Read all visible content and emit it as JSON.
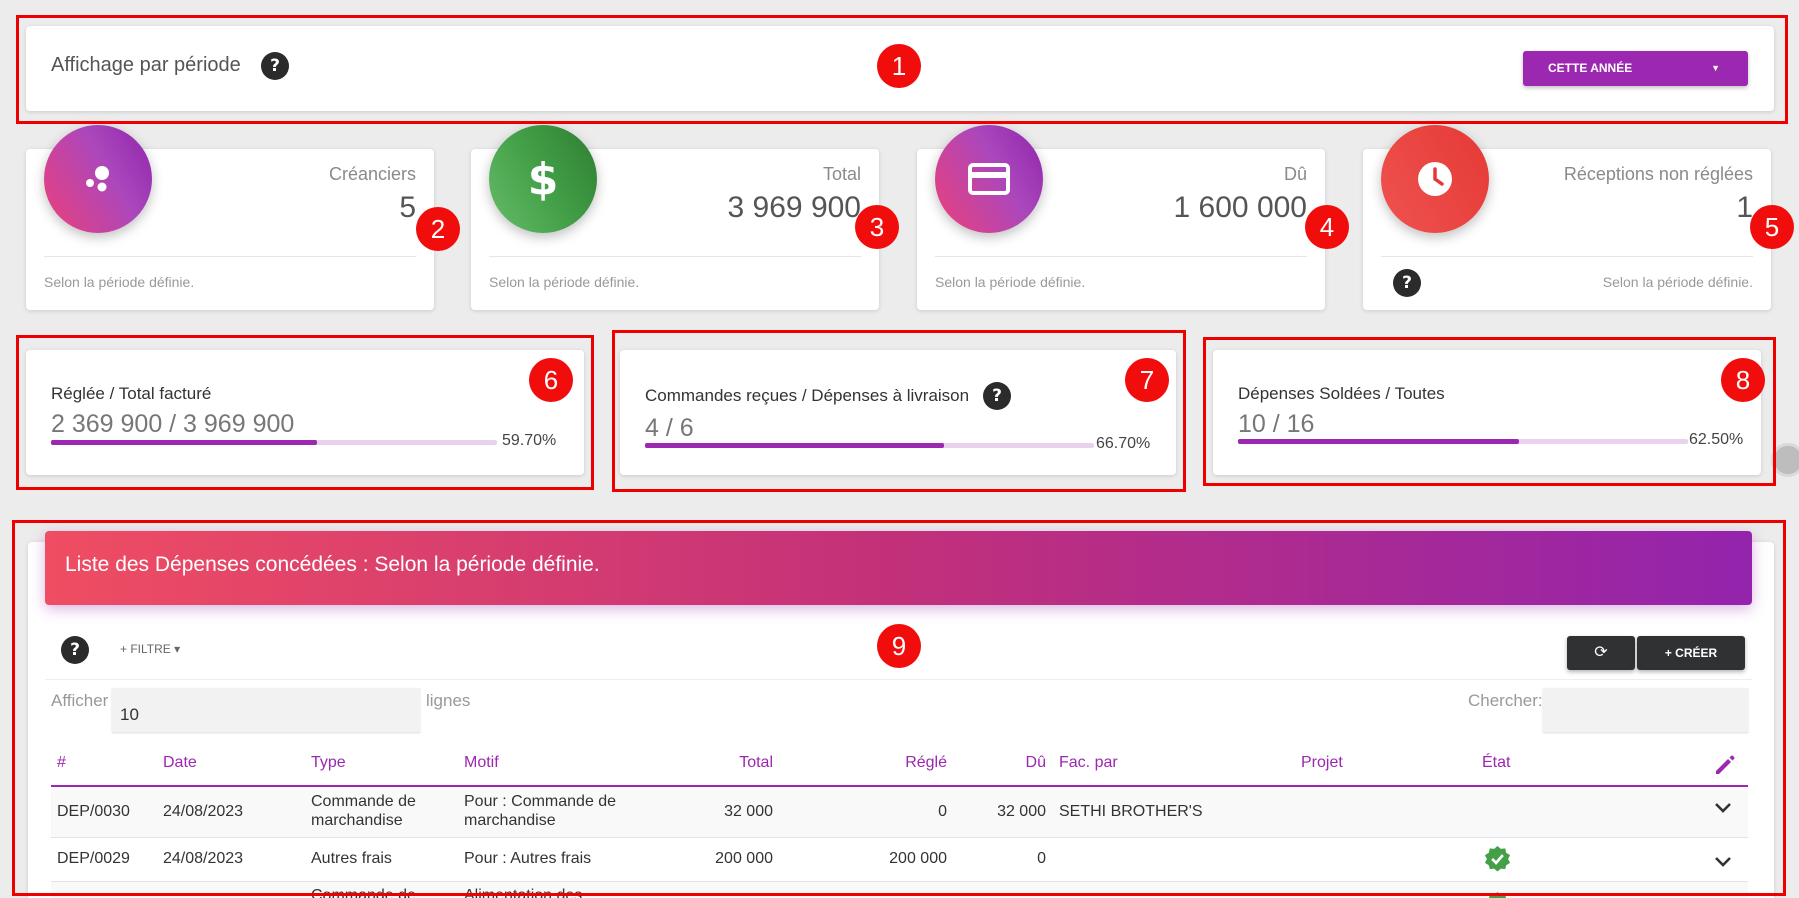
{
  "period": {
    "title": "Affichage par période",
    "help": "?",
    "button_label": "CETTE ANNÉE",
    "button_caret": "▼"
  },
  "stats": [
    {
      "icon": "bubbles-icon",
      "label": "Créanciers",
      "value": "5",
      "footer": "Selon la période définie."
    },
    {
      "icon": "dollar-icon",
      "label": "Total",
      "value": "3 969 900",
      "footer": "Selon la période définie."
    },
    {
      "icon": "credit-card-icon",
      "label": "Dû",
      "value": "1 600 000",
      "footer": "Selon la période définie."
    },
    {
      "icon": "clock-icon",
      "label": "Réceptions non réglées",
      "value": "1",
      "footer": "Selon la période définie.",
      "help": "?"
    }
  ],
  "progress": [
    {
      "label": "Réglée / Total facturé",
      "value": "2 369 900 / 3 969 900",
      "percent_text": "59.70%",
      "fraction": 0.597
    },
    {
      "label": "Commandes reçues / Dépenses à livraison",
      "value": "4 / 6",
      "percent_text": "66.70%",
      "fraction": 0.667,
      "help": "?"
    },
    {
      "label": "Dépenses Soldées / Toutes",
      "value": "10 / 16",
      "percent_text": "62.50%",
      "fraction": 0.625
    }
  ],
  "list": {
    "title": "Liste des Dépenses concédées : Selon la période définie.",
    "help": "?",
    "filter_label": "+ FILTRE ▾",
    "refresh_icon": "⟳",
    "create_label": "+ CRÉER",
    "show_label": "Afficher",
    "rows_value": "10",
    "rows_label": "lignes",
    "search_label": "Chercher:",
    "columns": [
      "#",
      "Date",
      "Type",
      "Motif",
      "Total",
      "Réglé",
      "Dû",
      "Fac. par",
      "Projet",
      "État"
    ],
    "rows": [
      {
        "id": "DEP/0030",
        "date": "24/08/2023",
        "type": "Commande de marchandise",
        "motif": "Pour : Commande de marchandise",
        "total": "32 000",
        "regle": "0",
        "du": "32 000",
        "fac_par": "SETHI BROTHER'S",
        "projet": "",
        "etat": "",
        "chevron": "⌄"
      },
      {
        "id": "DEP/0029",
        "date": "24/08/2023",
        "type": "Autres frais",
        "motif": "Pour : Autres frais",
        "total": "200 000",
        "regle": "200 000",
        "du": "0",
        "fac_par": "",
        "projet": "",
        "etat": "paid",
        "chevron": "⌄"
      },
      {
        "id": "",
        "date": "",
        "type": "Commande de",
        "motif": "Alimentation des",
        "total": "",
        "regle": "",
        "du": "",
        "fac_par": "",
        "projet": "",
        "etat": "paid",
        "chevron": ""
      }
    ]
  },
  "markers": [
    "1",
    "2",
    "3",
    "4",
    "5",
    "6",
    "7",
    "8",
    "9"
  ],
  "colors": {
    "primary": "#9c27b0",
    "marker": "#f20d0d",
    "success": "#43a047"
  }
}
